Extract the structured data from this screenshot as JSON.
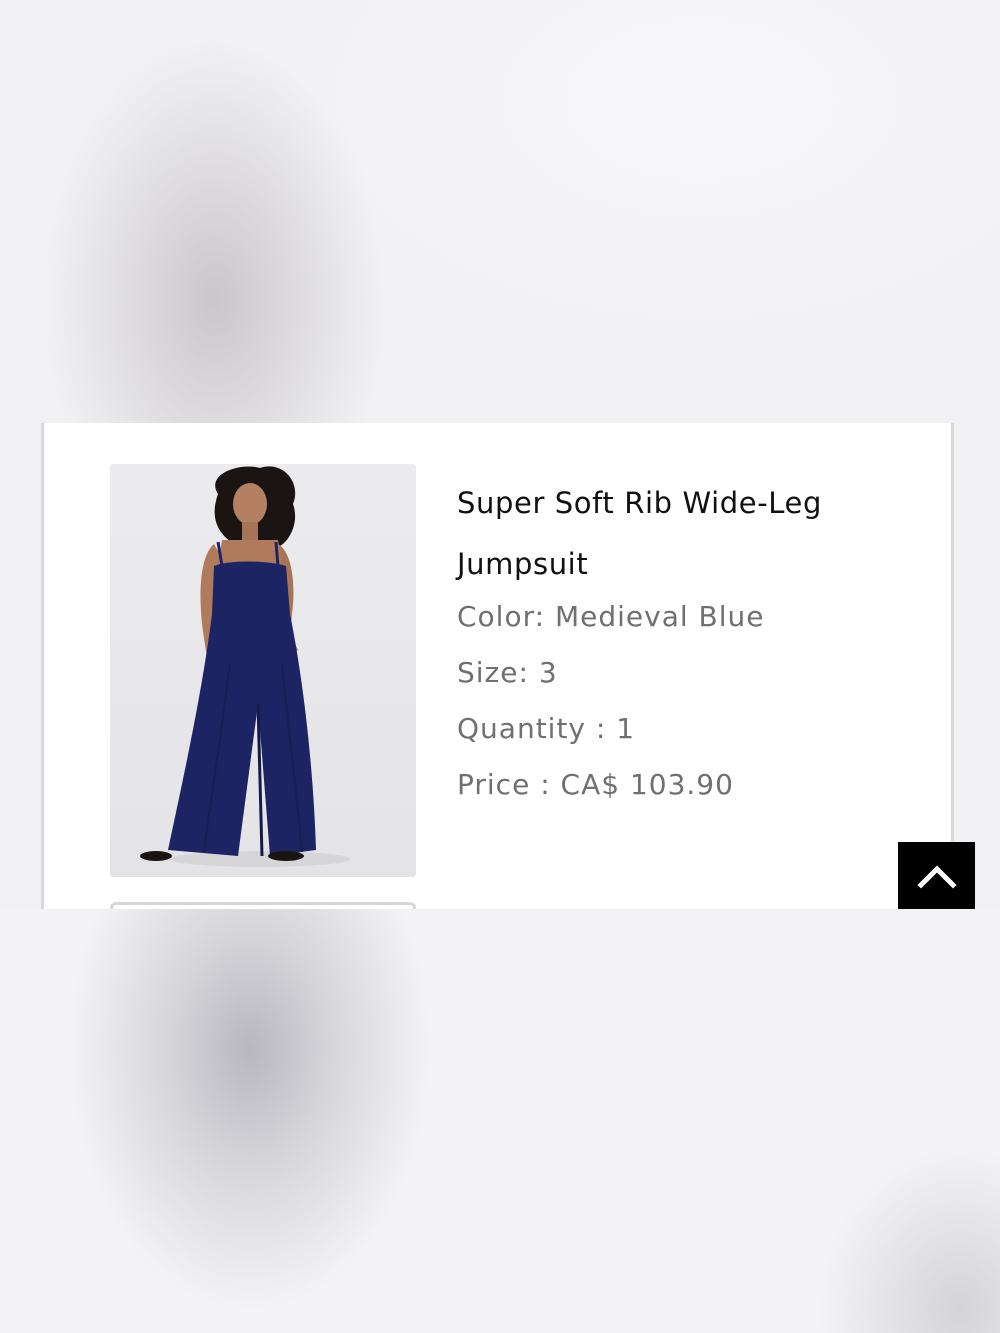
{
  "product": {
    "title_line_1": "Super Soft Rib Wide-Leg",
    "title_line_2": "Jumpsuit",
    "color_label": "Color:",
    "color_value": "Medieval Blue",
    "size_label": "Size:",
    "size_value": "3",
    "quantity_label": "Quantity :",
    "quantity_value": "1",
    "price_label": "Price :",
    "price_value": "CA$ 103.90",
    "image_icon": "product-photo-jumpsuit",
    "garment_color": "#1d2463"
  },
  "back_to_top": {
    "icon": "chevron-up-icon",
    "background": "#000000"
  }
}
